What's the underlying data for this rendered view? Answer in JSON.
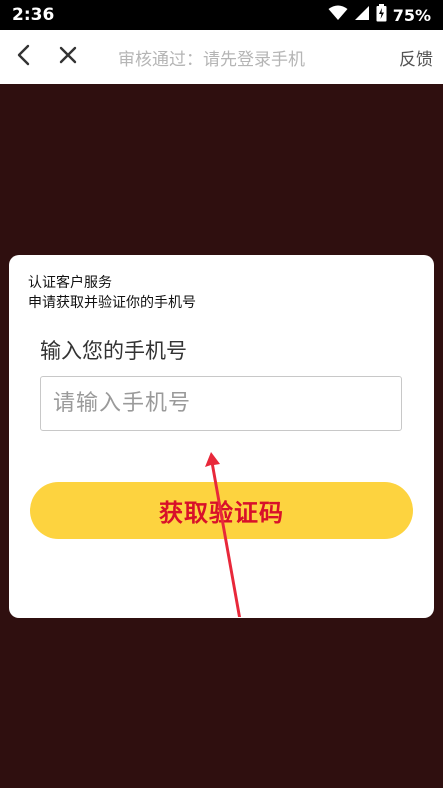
{
  "status_bar": {
    "time": "2:36",
    "battery_percent": "75%",
    "icons": [
      "wifi-icon",
      "cellular-signal-icon",
      "battery-icon"
    ]
  },
  "nav_bar": {
    "back_icon": "chevron-left-icon",
    "close_icon": "close-icon",
    "title": "审核通过：请先登录手机",
    "feedback_label": "反馈"
  },
  "dialog": {
    "title": "认证客户服务",
    "subtitle": "申请获取并验证你的手机号",
    "phone_label": "输入您的手机号",
    "phone_input": {
      "value": "",
      "placeholder": "请输入手机号"
    },
    "submit_label": "获取验证码"
  },
  "colors": {
    "background": "#2f0f0f",
    "button_fill": "#fdd33f",
    "button_text": "#d8102a",
    "annotation_arrow": "#e8283a"
  }
}
